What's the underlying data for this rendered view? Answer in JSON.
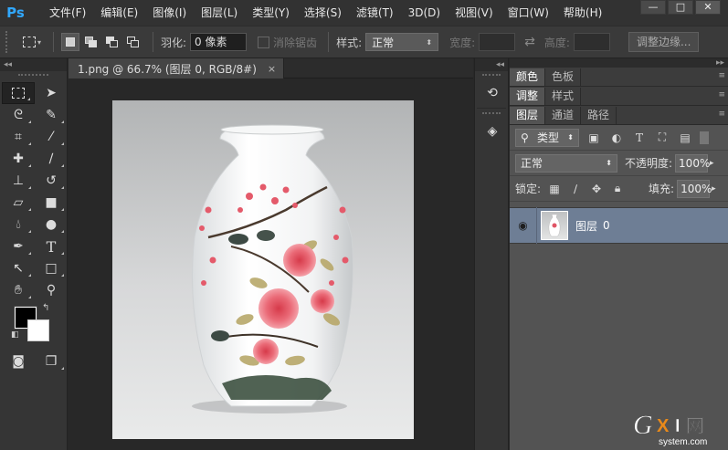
{
  "app": {
    "logo": "Ps"
  },
  "menu": [
    "文件(F)",
    "编辑(E)",
    "图像(I)",
    "图层(L)",
    "类型(Y)",
    "选择(S)",
    "滤镜(T)",
    "3D(D)",
    "视图(V)",
    "窗口(W)",
    "帮助(H)"
  ],
  "window_controls": {
    "minimize": "—",
    "maximize": "□",
    "close": "✕"
  },
  "options": {
    "feather_label": "羽化:",
    "feather_value": "0 像素",
    "antialias_label": "消除锯齿",
    "style_label": "样式:",
    "style_value": "正常",
    "width_label": "宽度:",
    "height_label": "高度:",
    "refine_button": "调整边缘..."
  },
  "document": {
    "tab_title": "1.png @ 66.7% (图层 0, RGB/8#)",
    "close": "×"
  },
  "panels": {
    "group1": [
      "颜色",
      "色板"
    ],
    "group2": [
      "调整",
      "样式"
    ],
    "layers_tabs": [
      "图层",
      "通道",
      "路径"
    ],
    "kind_label": "类型",
    "blend_mode": "正常",
    "opacity_label": "不透明度:",
    "opacity_value": "100%",
    "lock_label": "锁定:",
    "fill_label": "填充:",
    "fill_value": "100%",
    "layers": [
      {
        "name": "图层",
        "index": "0"
      }
    ]
  },
  "watermark": {
    "brand": "GXI",
    "suffix": "网",
    "url": "system.com"
  },
  "colors": {
    "accent": "#31a8ff",
    "layer_selected": "#6e7e95",
    "foreground": "#000000",
    "background": "#ffffff"
  }
}
